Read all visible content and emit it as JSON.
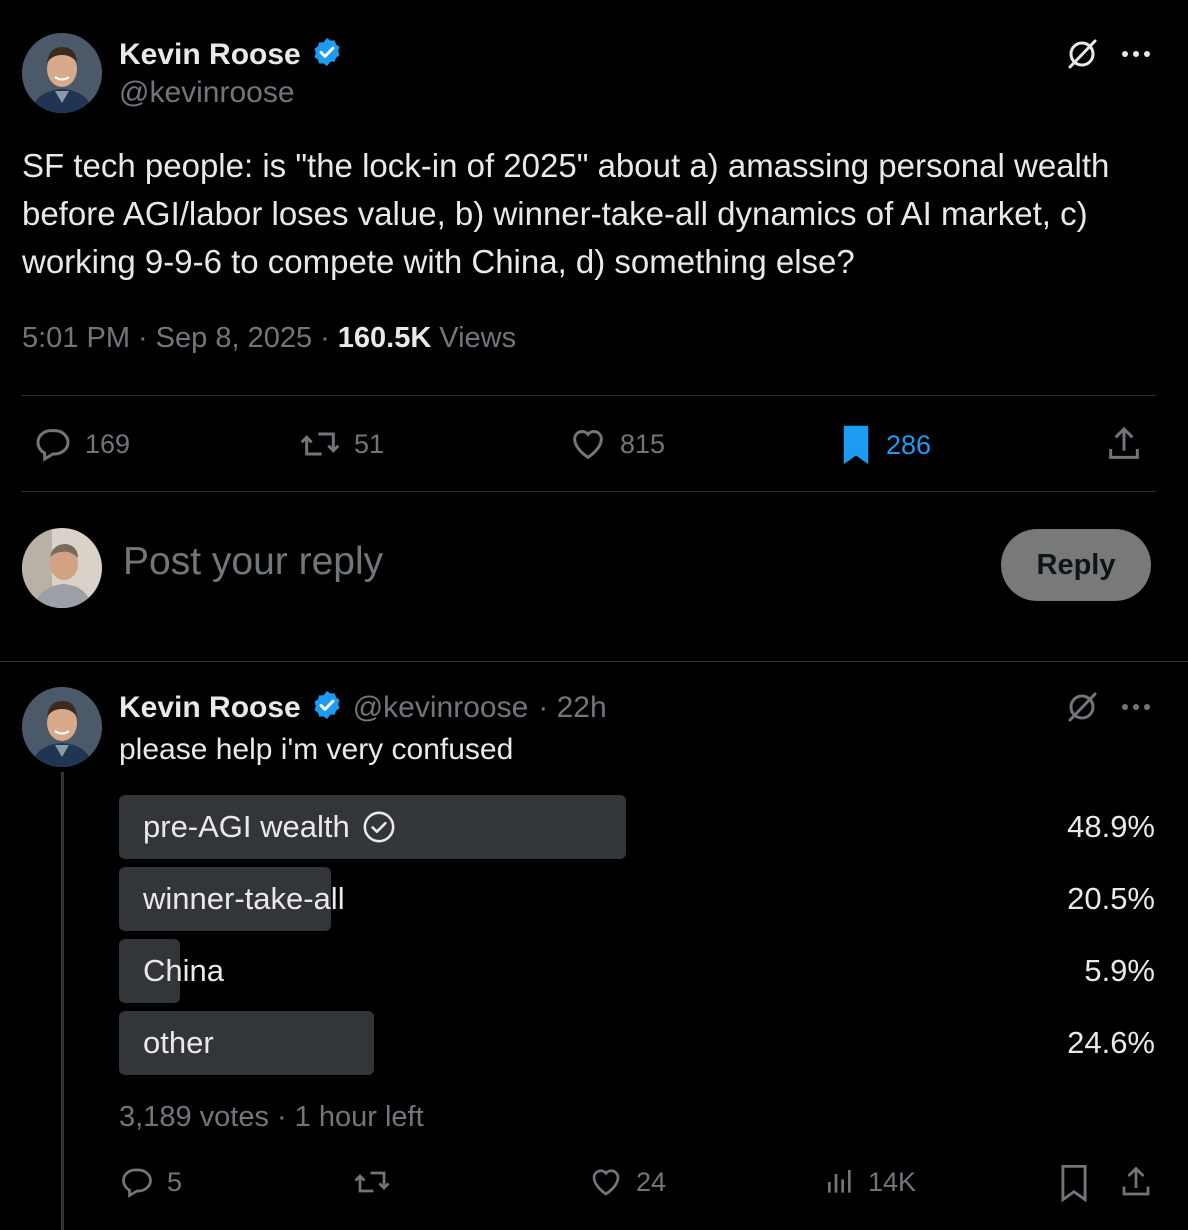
{
  "tweet": {
    "author_name": "Kevin Roose",
    "author_handle": "@kevinroose",
    "text": "SF tech people: is \"the lock-in of 2025\" about a) amassing personal wealth before AGI/labor loses value,  b) winner-take-all dynamics of AI market, c) working 9-9-6 to compete with China, d) something else?",
    "time": "5:01 PM",
    "date": "Sep 8, 2025",
    "sep": "·",
    "views_count": "160.5K",
    "views_label": "Views",
    "grok_icon": "grok-icon",
    "more_icon": "more-icon",
    "actions": {
      "replies": "169",
      "reposts": "51",
      "likes": "815",
      "bookmarks": "286"
    }
  },
  "composer": {
    "placeholder": "Post your reply",
    "reply_button": "Reply"
  },
  "reply": {
    "author_name": "Kevin Roose",
    "author_handle": "@kevinroose",
    "time_ago": "· 22h",
    "text": "please help i'm very confused",
    "poll": {
      "options": [
        {
          "label": "pre-AGI wealth",
          "percent": "48.9%",
          "value": 48.9,
          "selected": true
        },
        {
          "label": "winner-take-all",
          "percent": "20.5%",
          "value": 20.5,
          "selected": false
        },
        {
          "label": "China",
          "percent": "5.9%",
          "value": 5.9,
          "selected": false
        },
        {
          "label": "other",
          "percent": "24.6%",
          "value": 24.6,
          "selected": false
        }
      ],
      "votes": "3,189 votes",
      "time_left": "· 1 hour left"
    },
    "actions": {
      "replies": "5",
      "likes": "24",
      "views": "14K"
    }
  },
  "colors": {
    "background": "#000000",
    "text": "#e7e9ea",
    "muted": "#71767b",
    "accent": "#1d9bf0",
    "divider": "#2f3336",
    "poll_fill": "#333639",
    "reply_button_bg": "#787a7a"
  }
}
